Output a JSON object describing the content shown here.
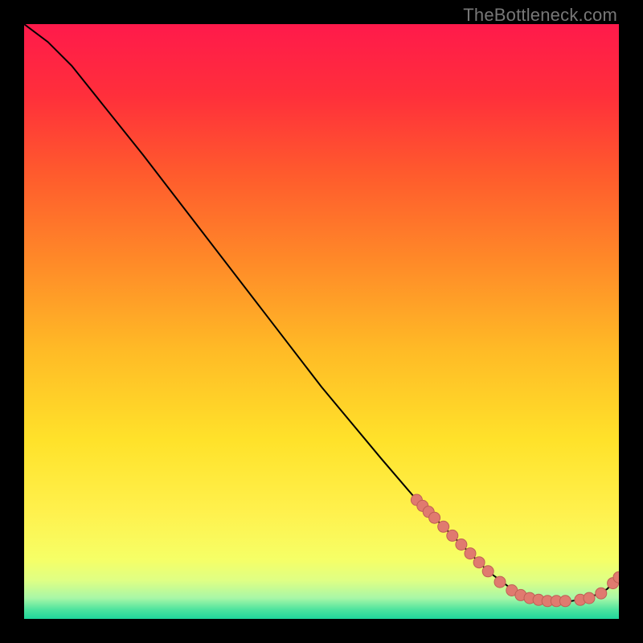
{
  "watermark": "TheBottleneck.com",
  "colors": {
    "bg": "#000000",
    "gradient_stops": [
      {
        "offset": 0.0,
        "color": "#ff1a4b"
      },
      {
        "offset": 0.12,
        "color": "#ff2f3b"
      },
      {
        "offset": 0.25,
        "color": "#ff5a2d"
      },
      {
        "offset": 0.4,
        "color": "#ff8a28"
      },
      {
        "offset": 0.55,
        "color": "#ffbb26"
      },
      {
        "offset": 0.7,
        "color": "#ffe22a"
      },
      {
        "offset": 0.82,
        "color": "#fff14d"
      },
      {
        "offset": 0.9,
        "color": "#f6ff66"
      },
      {
        "offset": 0.935,
        "color": "#dfff84"
      },
      {
        "offset": 0.965,
        "color": "#a8f7a7"
      },
      {
        "offset": 0.985,
        "color": "#4be39e"
      },
      {
        "offset": 1.0,
        "color": "#1fd69b"
      }
    ],
    "curve": "#000000",
    "marker_fill": "#e07a6f",
    "marker_stroke": "#bf5f55"
  },
  "chart_data": {
    "type": "line",
    "title": "",
    "xlabel": "",
    "ylabel": "",
    "xlim": [
      0,
      100
    ],
    "ylim": [
      0,
      100
    ],
    "curve": [
      {
        "x": 0,
        "y": 100
      },
      {
        "x": 4,
        "y": 97
      },
      {
        "x": 8,
        "y": 93
      },
      {
        "x": 12,
        "y": 88
      },
      {
        "x": 20,
        "y": 78
      },
      {
        "x": 30,
        "y": 65
      },
      {
        "x": 40,
        "y": 52
      },
      {
        "x": 50,
        "y": 39
      },
      {
        "x": 60,
        "y": 27
      },
      {
        "x": 66,
        "y": 20
      },
      {
        "x": 70,
        "y": 16
      },
      {
        "x": 74,
        "y": 12
      },
      {
        "x": 78,
        "y": 8
      },
      {
        "x": 82,
        "y": 5
      },
      {
        "x": 85,
        "y": 3.5
      },
      {
        "x": 88,
        "y": 3
      },
      {
        "x": 92,
        "y": 3
      },
      {
        "x": 95,
        "y": 3.5
      },
      {
        "x": 98,
        "y": 5
      },
      {
        "x": 100,
        "y": 7
      }
    ],
    "marker_points": [
      {
        "x": 66,
        "y": 20
      },
      {
        "x": 67,
        "y": 19
      },
      {
        "x": 68,
        "y": 18
      },
      {
        "x": 69,
        "y": 17
      },
      {
        "x": 70.5,
        "y": 15.5
      },
      {
        "x": 72,
        "y": 14
      },
      {
        "x": 73.5,
        "y": 12.5
      },
      {
        "x": 75,
        "y": 11
      },
      {
        "x": 76.5,
        "y": 9.5
      },
      {
        "x": 78,
        "y": 8
      },
      {
        "x": 80,
        "y": 6.2
      },
      {
        "x": 82,
        "y": 4.8
      },
      {
        "x": 83.5,
        "y": 4
      },
      {
        "x": 85,
        "y": 3.5
      },
      {
        "x": 86.5,
        "y": 3.2
      },
      {
        "x": 88,
        "y": 3
      },
      {
        "x": 89.5,
        "y": 3
      },
      {
        "x": 91,
        "y": 3
      },
      {
        "x": 93.5,
        "y": 3.2
      },
      {
        "x": 95,
        "y": 3.5
      },
      {
        "x": 97,
        "y": 4.3
      },
      {
        "x": 99,
        "y": 6
      },
      {
        "x": 100,
        "y": 7
      }
    ]
  }
}
